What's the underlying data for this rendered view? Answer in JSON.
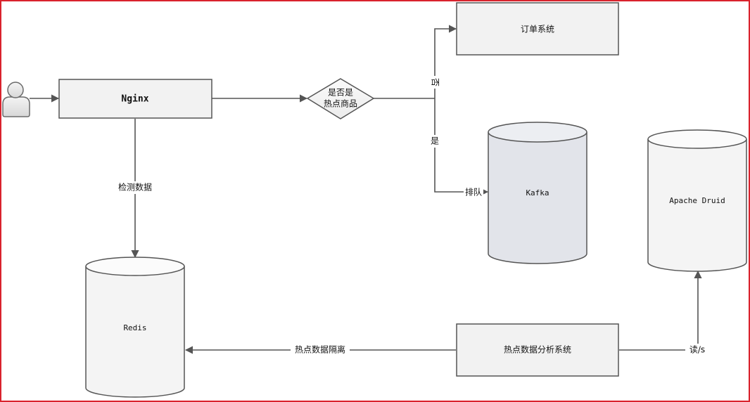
{
  "nodes": {
    "user": {
      "label": ""
    },
    "nginx": {
      "label": "Nginx"
    },
    "decision": {
      "line1": "是否是",
      "line2": "热点商品"
    },
    "order_system": {
      "label": "订单系统"
    },
    "kafka": {
      "label": "Kafka"
    },
    "apache_druid": {
      "label": "Apache Druid"
    },
    "redis": {
      "label": "Redis"
    },
    "hot_analysis": {
      "label": "热点数据分析系统"
    }
  },
  "edges": {
    "no_label": "否",
    "yes_label": "是",
    "queue_label": "排队",
    "detect_label": "检测数据",
    "isolate_label": "热点数据隔离",
    "rw_label": "读/s"
  },
  "colors": {
    "border": "#d9232d",
    "line": "#555555",
    "box_fill": "#f2f2f2",
    "kafka_fill": "#e2e4ea",
    "cylinder_fill": "#f4f4f4"
  }
}
